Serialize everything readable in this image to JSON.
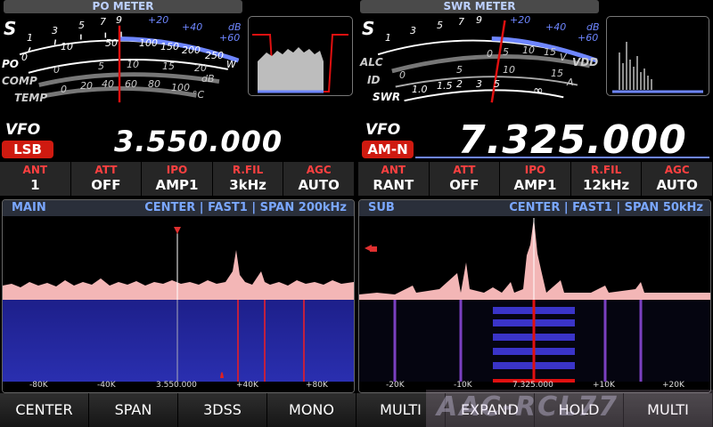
{
  "po_meter": {
    "title": "PO METER",
    "s_label": "S",
    "po_label": "PO",
    "comp_label": "COMP",
    "temp_label": "TEMP",
    "s_scale": [
      "1",
      "3",
      "5",
      "7",
      "9",
      "+20",
      "+40",
      "+60",
      "dB"
    ],
    "po_scale": [
      "0",
      "10",
      "50",
      "100",
      "150",
      "200",
      "250",
      "W"
    ],
    "comp_scale": [
      "0",
      "5",
      "10",
      "15",
      "20",
      "dB"
    ],
    "temp_scale": [
      "0",
      "20",
      "40",
      "60",
      "80",
      "100",
      "°C"
    ]
  },
  "swr_meter": {
    "title": "SWR METER",
    "s_label": "S",
    "alc_label": "ALC",
    "id_label": "ID",
    "swr_label": "SWR",
    "vdd_label": "VDD",
    "s_scale": [
      "1",
      "3",
      "5",
      "7",
      "9",
      "+20",
      "+40",
      "+60",
      "dB"
    ],
    "vdd_scale": [
      "0",
      "5",
      "10",
      "15",
      "V"
    ],
    "id_scale": [
      "0",
      "5",
      "10",
      "15",
      "A"
    ],
    "swr_scale": [
      "1.0",
      "1.5",
      "2",
      "3",
      "5",
      "∞"
    ]
  },
  "vfo_main": {
    "label": "VFO",
    "mode": "LSB",
    "frequency": "3.550.000"
  },
  "vfo_sub": {
    "label": "VFO",
    "mode": "AM-N",
    "frequency": "7.325.000"
  },
  "params_main": [
    {
      "label": "ANT",
      "value": "1"
    },
    {
      "label": "ATT",
      "value": "OFF"
    },
    {
      "label": "IPO",
      "value": "AMP1"
    },
    {
      "label": "R.FIL",
      "value": "3kHz"
    },
    {
      "label": "AGC",
      "value": "AUTO"
    }
  ],
  "params_sub": [
    {
      "label": "ANT",
      "value": "RANT"
    },
    {
      "label": "ATT",
      "value": "OFF"
    },
    {
      "label": "IPO",
      "value": "AMP1"
    },
    {
      "label": "R.FIL",
      "value": "12kHz"
    },
    {
      "label": "AGC",
      "value": "AUTO"
    }
  ],
  "scope_main": {
    "name": "MAIN",
    "status": "CENTER | FAST1 | SPAN   200kHz",
    "axis": [
      "-80K",
      "-40K",
      "3.550.000",
      "+40K",
      "+80K"
    ]
  },
  "scope_sub": {
    "name": "SUB",
    "status": "CENTER | FAST1 | SPAN   50kHz",
    "axis": [
      "-20K",
      "-10K",
      "7.325.000",
      "+10K",
      "+20K"
    ]
  },
  "softkeys": [
    "CENTER",
    "SPAN",
    "3DSS",
    "MONO",
    "MULTI",
    "EXPAND",
    "HOLD",
    "MULTI"
  ],
  "watermark": "AAC-RCL77",
  "colors": {
    "accent_blue": "#6e86ff",
    "red": "#cf1a10",
    "needle": "#e01010"
  }
}
